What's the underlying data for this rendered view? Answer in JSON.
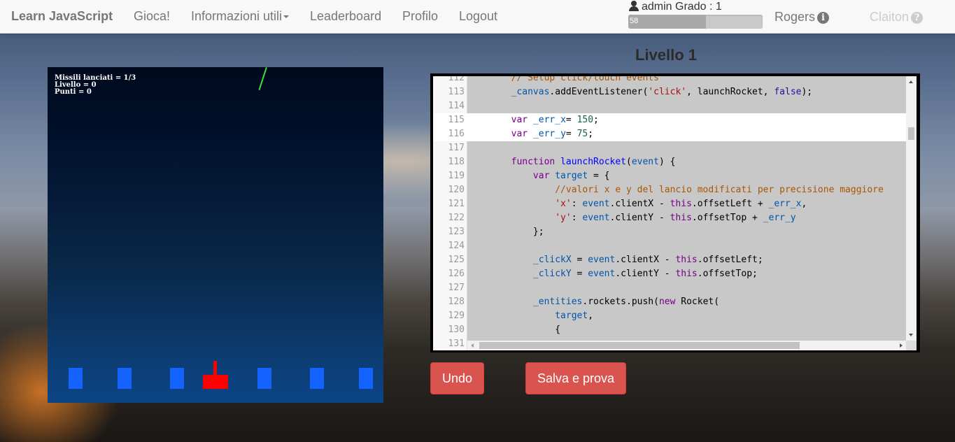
{
  "navbar": {
    "brand": "Learn JavaScript",
    "links": [
      "Gioca!",
      "Informazioni utili",
      "Leaderboard",
      "Profilo",
      "Logout"
    ],
    "user_text": "admin Grado : 1",
    "progress_value": 58,
    "progress_label": "58",
    "rivals": [
      {
        "name": "Rogers",
        "color": "#777777"
      },
      {
        "name": "Claiton",
        "color": "#cccccc"
      }
    ]
  },
  "game": {
    "hud": [
      "Missili lanciati = 1/3",
      "Livello = 0",
      "Punti = 0"
    ],
    "city_count": 6,
    "colors": {
      "city": "#1463ff",
      "launcher": "#ff0000",
      "missile": "#3ce03c"
    }
  },
  "level_title": "Livello 1",
  "editor": {
    "highlighted_lines": [
      115,
      116
    ],
    "lines": [
      {
        "n": "112",
        "t": "        // Setup click/touch events"
      },
      {
        "n": "113",
        "t": "        _canvas.addEventListener('click', launchRocket, false);"
      },
      {
        "n": "114",
        "t": ""
      },
      {
        "n": "115",
        "t": "        var _err_x= 150;"
      },
      {
        "n": "116",
        "t": "        var _err_y= 75;"
      },
      {
        "n": "117",
        "t": ""
      },
      {
        "n": "118",
        "t": "        function launchRocket(event) {"
      },
      {
        "n": "119",
        "t": "            var target = {"
      },
      {
        "n": "120",
        "t": "                //valori x e y del lancio modificati per precisione maggiore"
      },
      {
        "n": "121",
        "t": "                'x': event.clientX - this.offsetLeft + _err_x,"
      },
      {
        "n": "122",
        "t": "                'y': event.clientY - this.offsetTop + _err_y"
      },
      {
        "n": "123",
        "t": "            };"
      },
      {
        "n": "124",
        "t": ""
      },
      {
        "n": "125",
        "t": "            _clickX = event.clientX - this.offsetLeft;"
      },
      {
        "n": "126",
        "t": "            _clickY = event.clientY - this.offsetTop;"
      },
      {
        "n": "127",
        "t": ""
      },
      {
        "n": "128",
        "t": "            _entities.rockets.push(new Rocket("
      },
      {
        "n": "129",
        "t": "                target,"
      },
      {
        "n": "130",
        "t": "                {"
      },
      {
        "n": "131",
        "t": ""
      }
    ]
  },
  "buttons": {
    "undo": "Undo",
    "save": "Salva e prova"
  }
}
